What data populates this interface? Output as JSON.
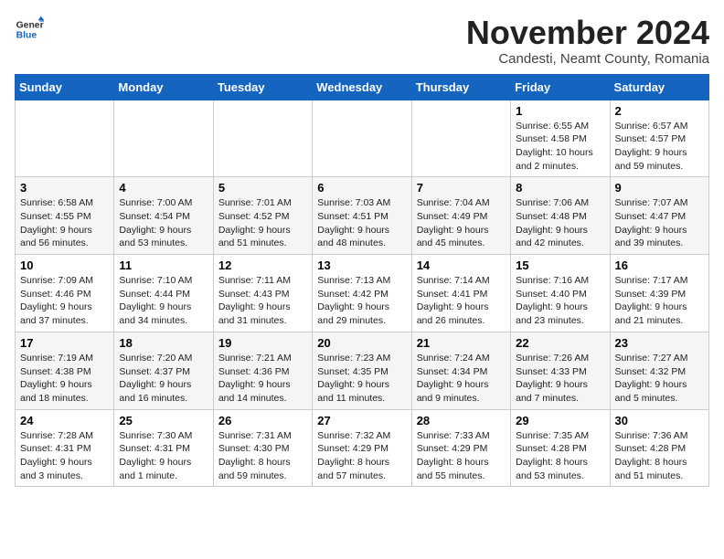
{
  "header": {
    "logo_general": "General",
    "logo_blue": "Blue",
    "month_title": "November 2024",
    "location": "Candesti, Neamt County, Romania"
  },
  "days_of_week": [
    "Sunday",
    "Monday",
    "Tuesday",
    "Wednesday",
    "Thursday",
    "Friday",
    "Saturday"
  ],
  "weeks": [
    [
      {
        "num": "",
        "info": ""
      },
      {
        "num": "",
        "info": ""
      },
      {
        "num": "",
        "info": ""
      },
      {
        "num": "",
        "info": ""
      },
      {
        "num": "",
        "info": ""
      },
      {
        "num": "1",
        "info": "Sunrise: 6:55 AM\nSunset: 4:58 PM\nDaylight: 10 hours\nand 2 minutes."
      },
      {
        "num": "2",
        "info": "Sunrise: 6:57 AM\nSunset: 4:57 PM\nDaylight: 9 hours\nand 59 minutes."
      }
    ],
    [
      {
        "num": "3",
        "info": "Sunrise: 6:58 AM\nSunset: 4:55 PM\nDaylight: 9 hours\nand 56 minutes."
      },
      {
        "num": "4",
        "info": "Sunrise: 7:00 AM\nSunset: 4:54 PM\nDaylight: 9 hours\nand 53 minutes."
      },
      {
        "num": "5",
        "info": "Sunrise: 7:01 AM\nSunset: 4:52 PM\nDaylight: 9 hours\nand 51 minutes."
      },
      {
        "num": "6",
        "info": "Sunrise: 7:03 AM\nSunset: 4:51 PM\nDaylight: 9 hours\nand 48 minutes."
      },
      {
        "num": "7",
        "info": "Sunrise: 7:04 AM\nSunset: 4:49 PM\nDaylight: 9 hours\nand 45 minutes."
      },
      {
        "num": "8",
        "info": "Sunrise: 7:06 AM\nSunset: 4:48 PM\nDaylight: 9 hours\nand 42 minutes."
      },
      {
        "num": "9",
        "info": "Sunrise: 7:07 AM\nSunset: 4:47 PM\nDaylight: 9 hours\nand 39 minutes."
      }
    ],
    [
      {
        "num": "10",
        "info": "Sunrise: 7:09 AM\nSunset: 4:46 PM\nDaylight: 9 hours\nand 37 minutes."
      },
      {
        "num": "11",
        "info": "Sunrise: 7:10 AM\nSunset: 4:44 PM\nDaylight: 9 hours\nand 34 minutes."
      },
      {
        "num": "12",
        "info": "Sunrise: 7:11 AM\nSunset: 4:43 PM\nDaylight: 9 hours\nand 31 minutes."
      },
      {
        "num": "13",
        "info": "Sunrise: 7:13 AM\nSunset: 4:42 PM\nDaylight: 9 hours\nand 29 minutes."
      },
      {
        "num": "14",
        "info": "Sunrise: 7:14 AM\nSunset: 4:41 PM\nDaylight: 9 hours\nand 26 minutes."
      },
      {
        "num": "15",
        "info": "Sunrise: 7:16 AM\nSunset: 4:40 PM\nDaylight: 9 hours\nand 23 minutes."
      },
      {
        "num": "16",
        "info": "Sunrise: 7:17 AM\nSunset: 4:39 PM\nDaylight: 9 hours\nand 21 minutes."
      }
    ],
    [
      {
        "num": "17",
        "info": "Sunrise: 7:19 AM\nSunset: 4:38 PM\nDaylight: 9 hours\nand 18 minutes."
      },
      {
        "num": "18",
        "info": "Sunrise: 7:20 AM\nSunset: 4:37 PM\nDaylight: 9 hours\nand 16 minutes."
      },
      {
        "num": "19",
        "info": "Sunrise: 7:21 AM\nSunset: 4:36 PM\nDaylight: 9 hours\nand 14 minutes."
      },
      {
        "num": "20",
        "info": "Sunrise: 7:23 AM\nSunset: 4:35 PM\nDaylight: 9 hours\nand 11 minutes."
      },
      {
        "num": "21",
        "info": "Sunrise: 7:24 AM\nSunset: 4:34 PM\nDaylight: 9 hours\nand 9 minutes."
      },
      {
        "num": "22",
        "info": "Sunrise: 7:26 AM\nSunset: 4:33 PM\nDaylight: 9 hours\nand 7 minutes."
      },
      {
        "num": "23",
        "info": "Sunrise: 7:27 AM\nSunset: 4:32 PM\nDaylight: 9 hours\nand 5 minutes."
      }
    ],
    [
      {
        "num": "24",
        "info": "Sunrise: 7:28 AM\nSunset: 4:31 PM\nDaylight: 9 hours\nand 3 minutes."
      },
      {
        "num": "25",
        "info": "Sunrise: 7:30 AM\nSunset: 4:31 PM\nDaylight: 9 hours\nand 1 minute."
      },
      {
        "num": "26",
        "info": "Sunrise: 7:31 AM\nSunset: 4:30 PM\nDaylight: 8 hours\nand 59 minutes."
      },
      {
        "num": "27",
        "info": "Sunrise: 7:32 AM\nSunset: 4:29 PM\nDaylight: 8 hours\nand 57 minutes."
      },
      {
        "num": "28",
        "info": "Sunrise: 7:33 AM\nSunset: 4:29 PM\nDaylight: 8 hours\nand 55 minutes."
      },
      {
        "num": "29",
        "info": "Sunrise: 7:35 AM\nSunset: 4:28 PM\nDaylight: 8 hours\nand 53 minutes."
      },
      {
        "num": "30",
        "info": "Sunrise: 7:36 AM\nSunset: 4:28 PM\nDaylight: 8 hours\nand 51 minutes."
      }
    ]
  ]
}
